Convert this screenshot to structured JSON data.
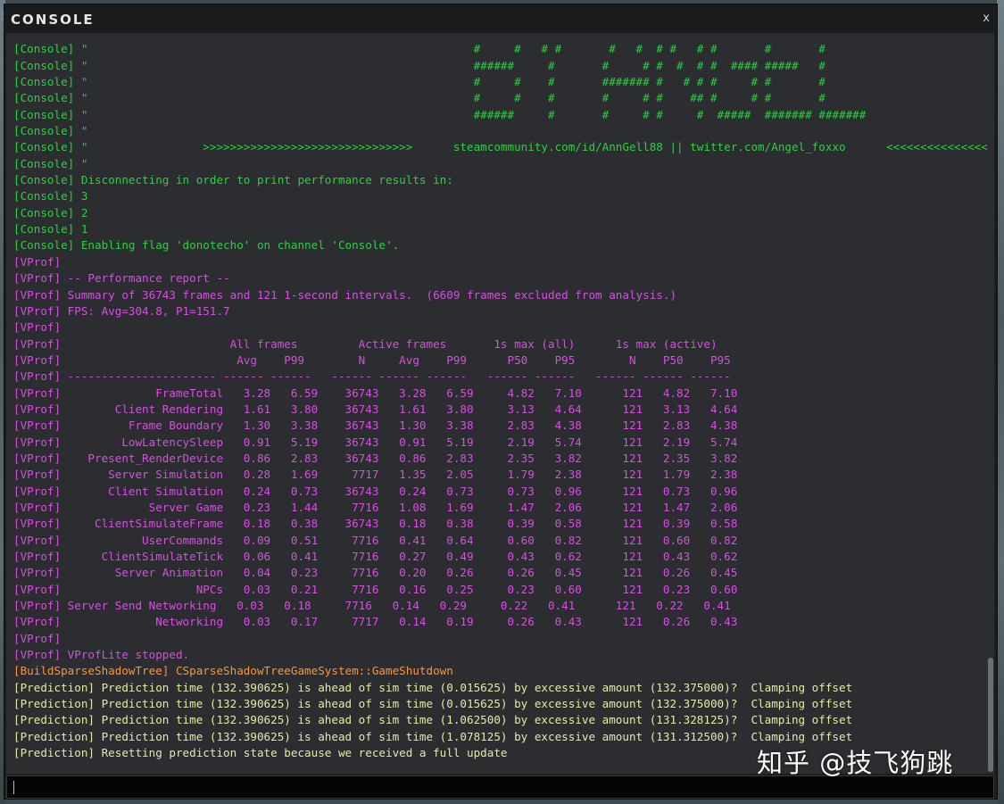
{
  "window": {
    "title": "CONSOLE",
    "close_label": "x",
    "left_edge_mark": "1"
  },
  "colors": {
    "console": "#28d13e",
    "vprof": "#d64fe0",
    "build": "#ff9530",
    "prediction": "#e7e9a6",
    "background": "#2b2d30"
  },
  "lines": [
    {
      "c": "console",
      "t": "[Console] \"                                                         #     #   # #       #   #  # #   # #       #       #"
    },
    {
      "c": "console",
      "t": "[Console] \"                                                         ######     #       #     # #  #  # #  #### #####   #"
    },
    {
      "c": "console",
      "t": "[Console] \"                                                         #     #    #       ####### #   # # #     # #       #"
    },
    {
      "c": "console",
      "t": "[Console] \"                                                         #     #    #       #     # #    ## #     # #       #"
    },
    {
      "c": "console",
      "t": "[Console] \"                                                         ######     #       #     # #     #  #####  ####### #######"
    },
    {
      "c": "console",
      "t": "[Console] \""
    },
    {
      "c": "console",
      "t": "[Console] \"                 >>>>>>>>>>>>>>>>>>>>>>>>>>>>>>>      steamcommunity.com/id/AnnGell88 || twitter.com/Angel_foxxo      <<<<<<<<<<<<<<<<"
    },
    {
      "c": "console",
      "t": "[Console] \""
    },
    {
      "c": "console",
      "t": "[Console] Disconnecting in order to print performance results in:"
    },
    {
      "c": "console",
      "t": "[Console] 3"
    },
    {
      "c": "console",
      "t": "[Console] 2"
    },
    {
      "c": "console",
      "t": "[Console] 1"
    },
    {
      "c": "console",
      "t": "[Console] Enabling flag 'donotecho' on channel 'Console'."
    },
    {
      "c": "vprof",
      "t": "[VProf]"
    },
    {
      "c": "vprof",
      "t": "[VProf] -- Performance report --"
    },
    {
      "c": "vprof",
      "t": "[VProf] Summary of 36743 frames and 121 1-second intervals.  (6609 frames excluded from analysis.)"
    },
    {
      "c": "vprof",
      "t": "[VProf] FPS: Avg=304.8, P1=151.7"
    },
    {
      "c": "vprof",
      "t": "[VProf]"
    },
    {
      "c": "vprof",
      "t": "[VProf]                         All frames         Active frames       1s max (all)      1s max (active)"
    },
    {
      "c": "vprof",
      "t": "[VProf]                          Avg    P99        N     Avg    P99      P50    P95        N    P50    P95"
    },
    {
      "c": "vprof",
      "t": "[VProf] ---------------------- ------ ------   ------ ------ ------   ------ ------   ------ ------ ------"
    },
    {
      "c": "vprof",
      "t": "[VProf]              FrameTotal   3.28   6.59    36743   3.28   6.59     4.82   7.10      121   4.82   7.10"
    },
    {
      "c": "vprof",
      "t": "[VProf]        Client Rendering   1.61   3.80    36743   1.61   3.80     3.13   4.64      121   3.13   4.64"
    },
    {
      "c": "vprof",
      "t": "[VProf]          Frame Boundary   1.30   3.38    36743   1.30   3.38     2.83   4.38      121   2.83   4.38"
    },
    {
      "c": "vprof",
      "t": "[VProf]         LowLatencySleep   0.91   5.19    36743   0.91   5.19     2.19   5.74      121   2.19   5.74"
    },
    {
      "c": "vprof",
      "t": "[VProf]    Present_RenderDevice   0.86   2.83    36743   0.86   2.83     2.35   3.82      121   2.35   3.82"
    },
    {
      "c": "vprof",
      "t": "[VProf]       Server Simulation   0.28   1.69     7717   1.35   2.05     1.79   2.38      121   1.79   2.38"
    },
    {
      "c": "vprof",
      "t": "[VProf]       Client Simulation   0.24   0.73    36743   0.24   0.73     0.73   0.96      121   0.73   0.96"
    },
    {
      "c": "vprof",
      "t": "[VProf]             Server Game   0.23   1.44     7716   1.08   1.69     1.47   2.06      121   1.47   2.06"
    },
    {
      "c": "vprof",
      "t": "[VProf]     ClientSimulateFrame   0.18   0.38    36743   0.18   0.38     0.39   0.58      121   0.39   0.58"
    },
    {
      "c": "vprof",
      "t": "[VProf]            UserCommands   0.09   0.51     7716   0.41   0.64     0.60   0.82      121   0.60   0.82"
    },
    {
      "c": "vprof",
      "t": "[VProf]      ClientSimulateTick   0.06   0.41     7716   0.27   0.49     0.43   0.62      121   0.43   0.62"
    },
    {
      "c": "vprof",
      "t": "[VProf]        Server Animation   0.04   0.23     7716   0.20   0.26     0.26   0.45      121   0.26   0.45"
    },
    {
      "c": "vprof",
      "t": "[VProf]                    NPCs   0.03   0.21     7716   0.16   0.25     0.23   0.60      121   0.23   0.60"
    },
    {
      "c": "vprof",
      "t": "[VProf] Server Send Networking   0.03   0.18     7716   0.14   0.29     0.22   0.41      121   0.22   0.41"
    },
    {
      "c": "vprof",
      "t": "[VProf]              Networking   0.03   0.17     7717   0.14   0.19     0.26   0.43      121   0.26   0.43"
    },
    {
      "c": "vprof",
      "t": "[VProf]"
    },
    {
      "c": "vprof",
      "t": "[VProf] VProfLite stopped."
    },
    {
      "c": "build",
      "t": "[BuildSparseShadowTree] CSparseShadowTreeGameSystem::GameShutdown"
    },
    {
      "c": "pred",
      "t": "[Prediction] Prediction time (132.390625) is ahead of sim time (0.015625) by excessive amount (132.375000)?  Clamping offset"
    },
    {
      "c": "pred",
      "t": "[Prediction] Prediction time (132.390625) is ahead of sim time (0.015625) by excessive amount (132.375000)?  Clamping offset"
    },
    {
      "c": "pred",
      "t": "[Prediction] Prediction time (132.390625) is ahead of sim time (1.062500) by excessive amount (131.328125)?  Clamping offset"
    },
    {
      "c": "pred",
      "t": "[Prediction] Prediction time (132.390625) is ahead of sim time (1.078125) by excessive amount (131.312500)?  Clamping offset"
    },
    {
      "c": "pred",
      "t": "[Prediction] Resetting prediction state because we received a full update"
    }
  ],
  "input": {
    "value": ""
  },
  "watermark": "知乎 @技飞狗跳"
}
